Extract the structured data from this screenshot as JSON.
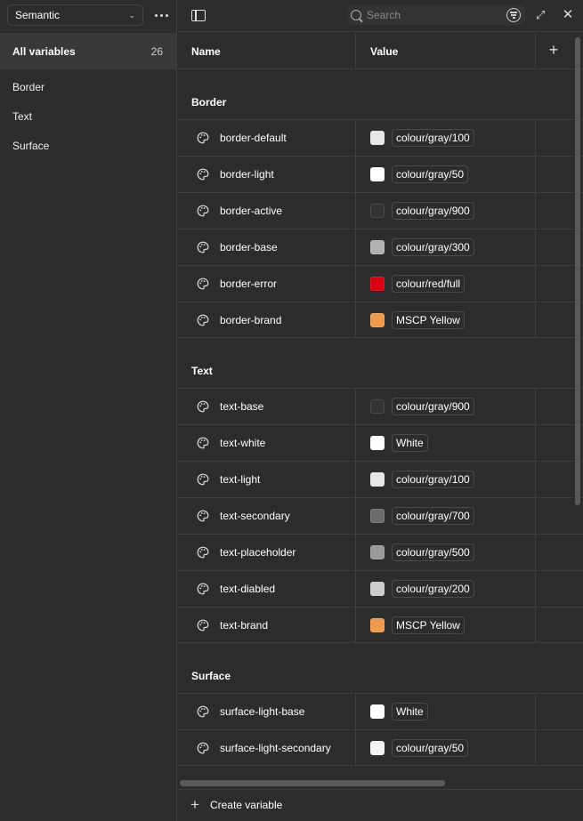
{
  "sidebar": {
    "collection": "Semantic",
    "all_label": "All variables",
    "all_count": "26",
    "groups": [
      "Border",
      "Text",
      "Surface"
    ]
  },
  "search": {
    "placeholder": "Search"
  },
  "table": {
    "name_header": "Name",
    "value_header": "Value"
  },
  "groups": [
    {
      "title": "Border",
      "rows": [
        {
          "name": "border-default",
          "value": "colour/gray/100",
          "color": "#e6e6e6"
        },
        {
          "name": "border-light",
          "value": "colour/gray/50",
          "color": "#ffffff"
        },
        {
          "name": "border-active",
          "value": "colour/gray/900",
          "color": "#333333"
        },
        {
          "name": "border-base",
          "value": "colour/gray/300",
          "color": "#b3b3b3"
        },
        {
          "name": "border-error",
          "value": "colour/red/full",
          "color": "#d90011"
        },
        {
          "name": "border-brand",
          "value": "MSCP Yellow",
          "color": "#ee9a4c"
        }
      ]
    },
    {
      "title": "Text",
      "rows": [
        {
          "name": "text-base",
          "value": "colour/gray/900",
          "color": "#333333"
        },
        {
          "name": "text-white",
          "value": "White",
          "color": "#ffffff"
        },
        {
          "name": "text-light",
          "value": "colour/gray/100",
          "color": "#e6e6e6"
        },
        {
          "name": "text-secondary",
          "value": "colour/gray/700",
          "color": "#6b6b6b"
        },
        {
          "name": "text-placeholder",
          "value": "colour/gray/500",
          "color": "#999999"
        },
        {
          "name": "text-diabled",
          "value": "colour/gray/200",
          "color": "#cccccc"
        },
        {
          "name": "text-brand",
          "value": "MSCP Yellow",
          "color": "#ee9a4c"
        }
      ]
    },
    {
      "title": "Surface",
      "rows": [
        {
          "name": "surface-light-base",
          "value": "White",
          "color": "#ffffff"
        },
        {
          "name": "surface-light-secondary",
          "value": "colour/gray/50",
          "color": "#f5f5f5"
        }
      ]
    }
  ],
  "footer": {
    "create_label": "Create variable"
  }
}
